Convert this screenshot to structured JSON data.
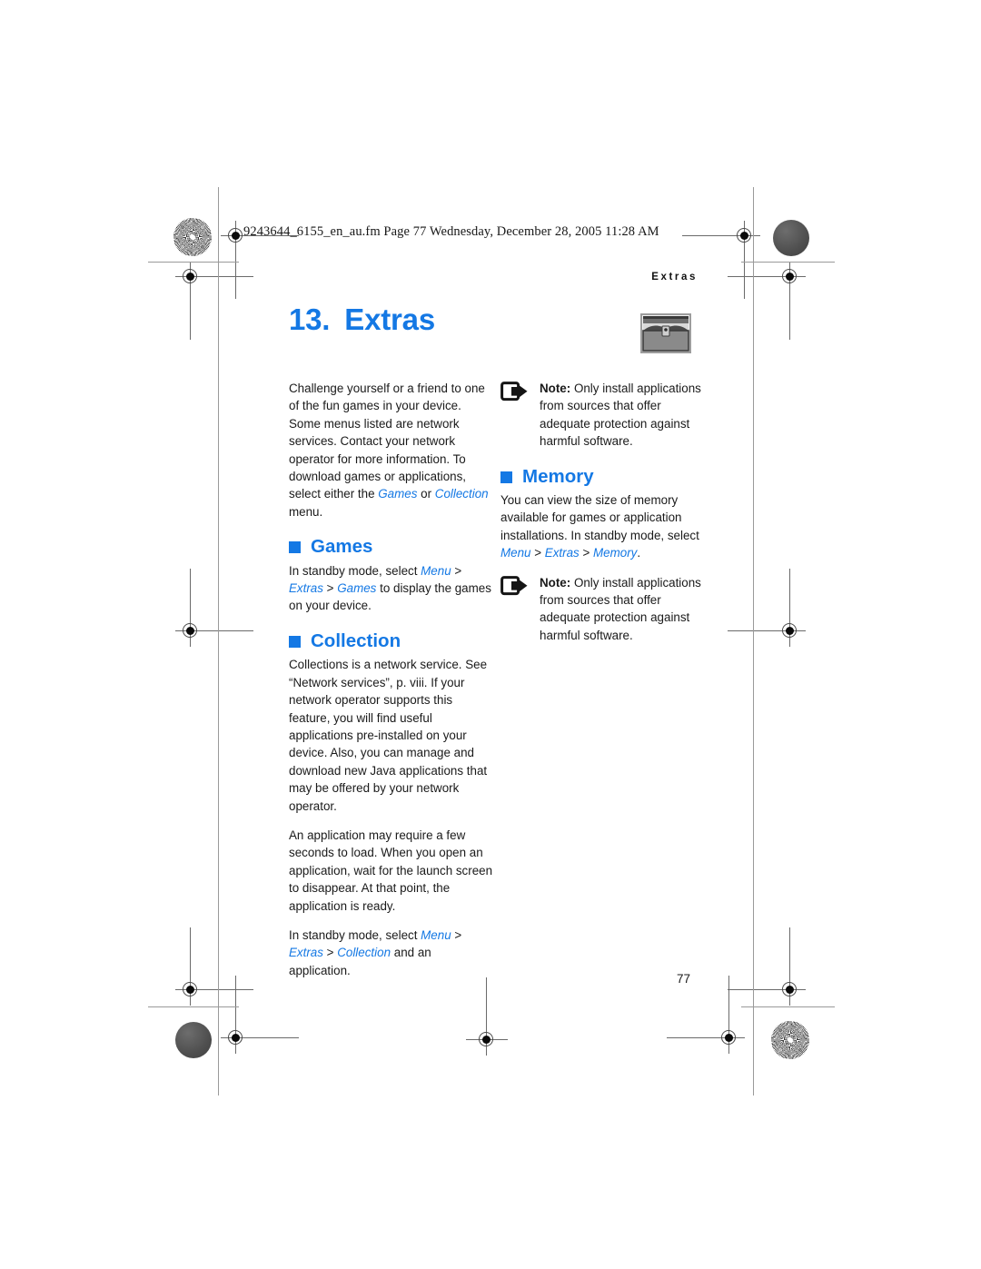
{
  "print_marks": {
    "file_info": "9243644_6155_en_au.fm  Page 77  Wednesday, December 28, 2005  11:28 AM",
    "running_head": "Extras"
  },
  "chapter": {
    "number": "13.",
    "title": "Extras",
    "icon": "treasure-chest-icon",
    "accent_color": "#1478e4"
  },
  "left_column": {
    "intro": {
      "text_before": "Challenge yourself or a friend to one of the fun games in your device. Some menus listed are network services. Contact your network operator for more information. To download games or applications, select either the ",
      "ui_games": "Games",
      "joiner": " or ",
      "ui_collection": "Collection",
      "text_after": " menu."
    },
    "games_section": {
      "heading": "Games",
      "path_intro": "In standby mode, select ",
      "path_menu": "Menu",
      "sep1": " > ",
      "path_extras": "Extras",
      "sep2": " > ",
      "path_games": "Games",
      "path_tail": " to display the games on your device."
    },
    "collection_section": {
      "heading": "Collection",
      "para1": "Collections is a network service. See “Network services”, p. viii. If your network operator supports this feature, you will find useful applications pre-installed on your device. Also, you can manage and download new Java applications that may be offered by your network operator.",
      "para2": "An application may require a few seconds to load. When you open an application, wait for the launch screen to disappear. At that point, the application is ready.",
      "path_intro": "In standby mode, select ",
      "path_menu": "Menu",
      "sep1": " > ",
      "path_extras": "Extras",
      "sep2": " > ",
      "path_collection": "Collection",
      "path_tail": " and an application."
    }
  },
  "right_column": {
    "note_top": {
      "icon": "note-arrow-icon",
      "label": "Note:",
      "text": " Only install applications from sources that offer adequate protection against harmful software."
    },
    "memory_section": {
      "heading": "Memory",
      "para_intro": "You can view the size of memory available for games or application installations. In standby mode, select ",
      "path_menu": "Menu",
      "sep1": " > ",
      "path_extras": "Extras",
      "sep2": " > ",
      "path_memory": "Memory",
      "path_tail": "."
    },
    "note_bottom": {
      "icon": "note-arrow-icon",
      "label": "Note:",
      "text": " Only install applications from sources that offer adequate protection against harmful software."
    }
  },
  "footer": {
    "page_number": "77"
  }
}
